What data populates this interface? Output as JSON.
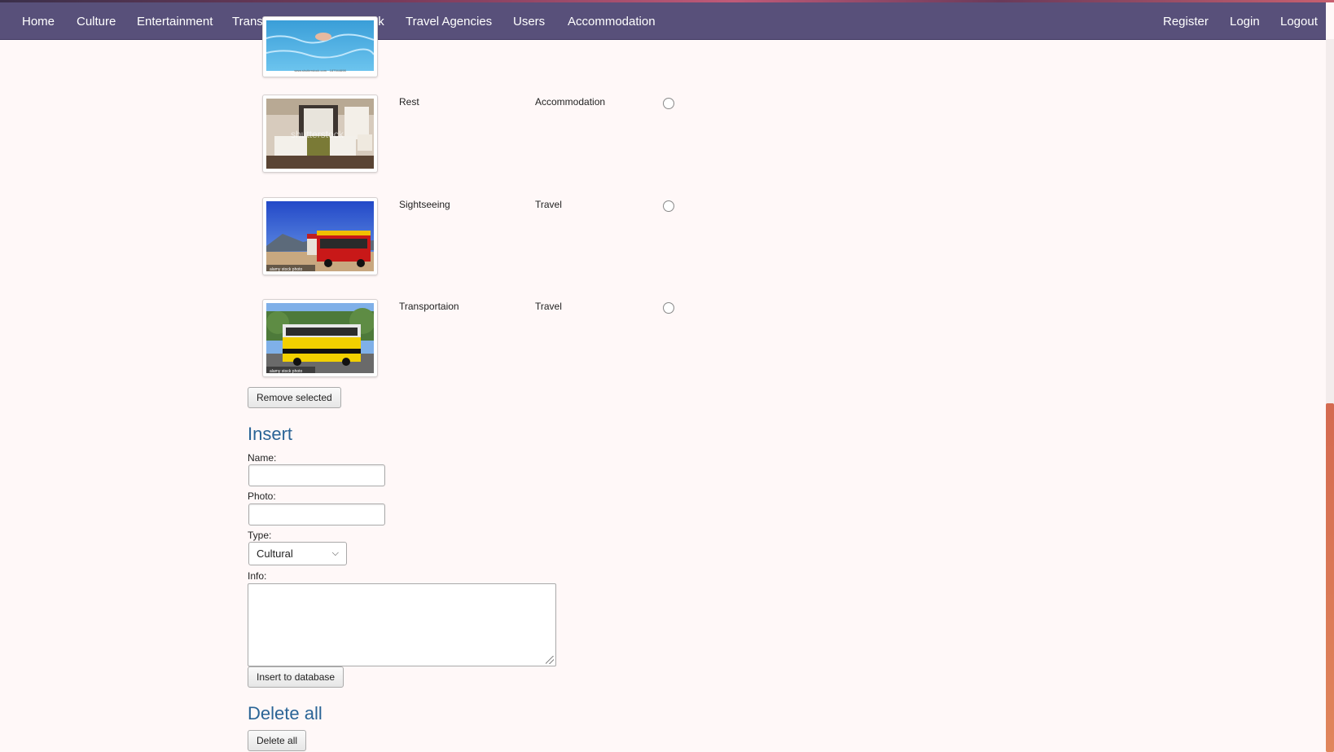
{
  "nav": {
    "left": [
      "Home",
      "Culture",
      "Entertainment",
      "Transportation",
      "Landmark",
      "Travel Agencies",
      "Users",
      "Accommodation"
    ],
    "right": [
      "Register",
      "Login",
      "Logout"
    ]
  },
  "rows": [
    {
      "name": "Rest",
      "type": "Accommodation",
      "image": "hotel-room-photo"
    },
    {
      "name": "Sightseeing",
      "type": "Travel",
      "image": "trolley-bus-photo"
    },
    {
      "name": "Transportaion",
      "type": "Travel",
      "image": "city-bus-photo"
    }
  ],
  "remove_button": "Remove selected",
  "insert": {
    "heading": "Insert",
    "name_label": "Name:",
    "photo_label": "Photo:",
    "type_label": "Type:",
    "type_value": "Cultural",
    "info_label": "Info:",
    "submit": "Insert to database"
  },
  "delete": {
    "heading": "Delete all",
    "button": "Delete all"
  },
  "colors": {
    "navbar": "#58507a",
    "heading": "#2a6496",
    "scroll_thumb": "#d46a50"
  }
}
